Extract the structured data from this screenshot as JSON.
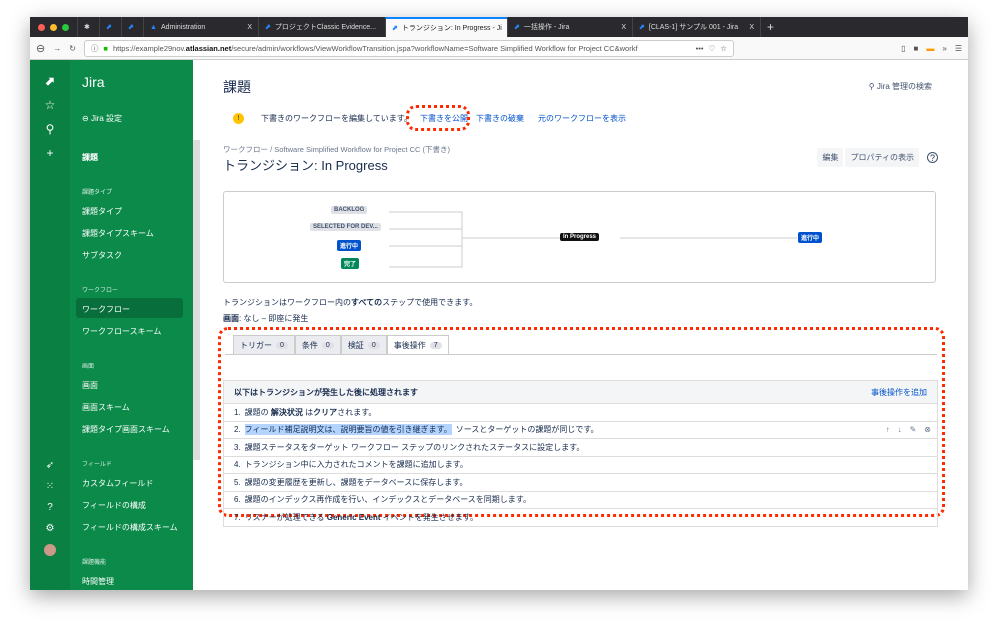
{
  "browser": {
    "tabs": [
      {
        "label": "Administration"
      },
      {
        "label": "プロジェクトClassic Evidence..."
      },
      {
        "label": "トランジション: In Progress - Ji"
      },
      {
        "label": "一括操作 - Jira"
      },
      {
        "label": "[CLAS-1] サンプル 001 - Jira"
      }
    ],
    "url_prefix": "https://example29nov.",
    "url_domain": "atlassian.net",
    "url_rest": "/secure/admin/workflows/ViewWorkflowTransition.jspa?workflowName=Software Simplified Workflow for Project CC&workf"
  },
  "sidebar": {
    "app": "Jira",
    "back": "Jira 設定",
    "top": "課題",
    "sections": [
      {
        "h": "課題タイプ"
      },
      {
        "h": "ワークフロー"
      },
      {
        "h": "画面"
      },
      {
        "h": "フィールド"
      },
      {
        "h": "課題機能"
      }
    ],
    "items": [
      "課題タイプ",
      "課題タイプスキーム",
      "サブタスク",
      "ワークフロー",
      "ワークフロースキーム",
      "画面",
      "画面スキーム",
      "課題タイプ画面スキーム",
      "カスタムフィールド",
      "フィールドの構成",
      "フィールドの構成スキーム",
      "時間管理"
    ]
  },
  "header": {
    "title": "課題",
    "search": "Jira 管理の検索"
  },
  "draft": {
    "msg": "下書きのワークフローを編集しています。",
    "publish": "下書きを公開",
    "discard": "下書きの破棄",
    "view_orig": "元のワークフローを表示"
  },
  "breadcrumb": {
    "root": "ワークフロー",
    "sep": "/",
    "name": "Software Simplified Workflow for Project CC (下書き)"
  },
  "page_title": "トランジション: In Progress",
  "actions": {
    "edit": "編集",
    "props": "プロパティの表示"
  },
  "diagram": {
    "from": [
      "BACKLOG",
      "SELECTED FOR DEV...",
      "進行中",
      "完了"
    ],
    "transition": "In Progress",
    "to": "進行中"
  },
  "info": {
    "t1": "トランジションはワークフロー内の",
    "t1b": "すべての",
    "t1c": "ステップで使用できます。",
    "screen_label": "画面",
    "screen_val": ": なし – 即座に発生"
  },
  "tabs": [
    {
      "label": "トリガー",
      "count": "0"
    },
    {
      "label": "条件",
      "count": "0"
    },
    {
      "label": "検証",
      "count": "0"
    },
    {
      "label": "事後操作",
      "count": "7"
    }
  ],
  "postfn": {
    "header": "以下はトランジションが発生した後に処理されます",
    "add": "事後操作を追加",
    "rows": [
      {
        "n": "1.",
        "a": "課題の ",
        "b": "解決状況",
        "c": " は",
        "d": "クリア",
        "e": "されます。"
      },
      {
        "n": "2.",
        "hl": "フィールド補足説明文は、説明要旨の値を引き継ぎます。",
        "rest": "ソースとターゲットの課題が同じです。"
      },
      {
        "n": "3.",
        "t": "課題ステータスをターゲット ワークフロー ステップのリンクされたステータスに設定します。"
      },
      {
        "n": "4.",
        "t": "トランジション中に入力されたコメントを課題に追加します。"
      },
      {
        "n": "5.",
        "t": "課題の変更履歴を更新し、課題をデータベースに保存します。"
      },
      {
        "n": "6.",
        "t": "課題のインデックス再作成を行い、インデックスとデータベースを同期します。"
      },
      {
        "n": "7.",
        "a": "リスナーが処理できる ",
        "b": "Generic Event",
        "c": " イベントを発生させます。"
      }
    ]
  }
}
